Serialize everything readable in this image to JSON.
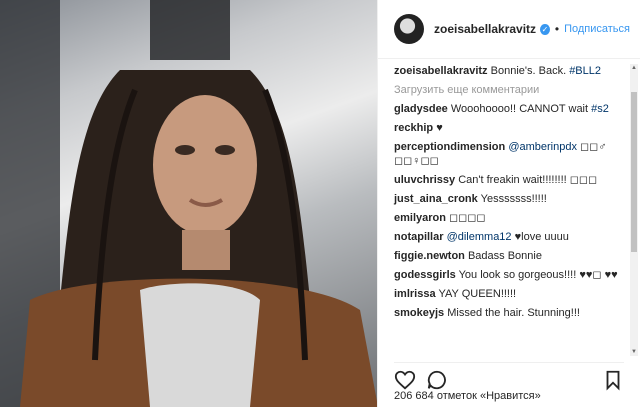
{
  "header": {
    "username": "zoeisabellakravitz",
    "separator": "•",
    "follow_label": "Подписаться"
  },
  "caption": {
    "user": "zoeisabellakravitz",
    "text": "Bonnie's. Back. #BLL2"
  },
  "load_more": "Загрузить еще комментарии",
  "comments": [
    {
      "user": "gladysdee",
      "text": "Wooohoooo!! CANNOT wait #s2"
    },
    {
      "user": "reckhip",
      "text": "♥"
    },
    {
      "user": "perceptiondimension",
      "text": "@amberinpdx ◻◻♂ ◻◻♀◻◻"
    },
    {
      "user": "uluvchrissy",
      "text": "Can't freakin wait!!!!!!!! ◻◻◻"
    },
    {
      "user": "just_aina_cronk",
      "text": "Yesssssss!!!!!"
    },
    {
      "user": "emilyaron",
      "text": "◻◻◻◻"
    },
    {
      "user": "notapillar",
      "text": "@dilemma12 ♥love uuuu"
    },
    {
      "user": "figgie.newton",
      "text": "Badass Bonnie"
    },
    {
      "user": "godessgirls",
      "text": "You look so gorgeous!!!! ♥♥◻ ♥♥"
    },
    {
      "user": "imlrissa",
      "text": "YAY QUEEN!!!!!"
    },
    {
      "user": "smokeyjs",
      "text": "Missed the hair. Stunning!!!"
    }
  ],
  "likes_text": "206 684 отметок «Нравится»",
  "icons": {
    "verified": "verified-badge-icon",
    "like": "heart-icon",
    "comment": "comment-bubble-icon",
    "save": "bookmark-icon"
  },
  "colors": {
    "link": "#3897f0",
    "verified": "#3897f0",
    "muted": "#999999"
  }
}
